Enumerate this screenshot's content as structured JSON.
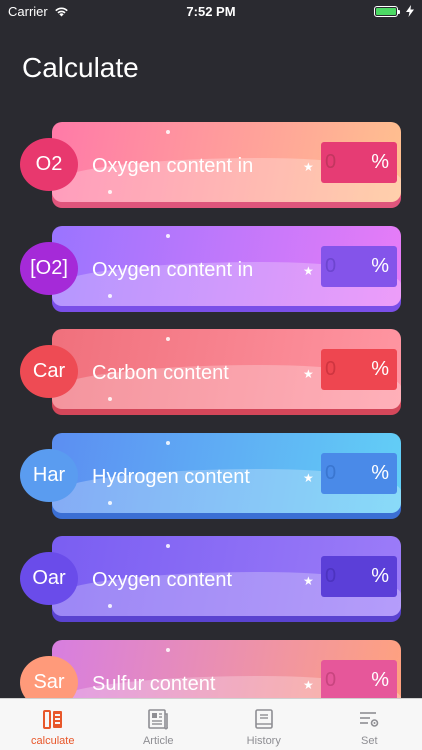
{
  "status_bar": {
    "carrier": "Carrier",
    "time": "7:52 PM"
  },
  "page_title": "Calculate",
  "cards": [
    {
      "badge": "O2",
      "label": "Oxygen content in",
      "value": "0",
      "unit": "%",
      "colors": {
        "from": "#ff7aa8",
        "to": "#ffc08f",
        "shadow": "#e0557c",
        "badge": "#e8386e",
        "input": "#e63c74",
        "placeholder": "#c2365f"
      }
    },
    {
      "badge": "[O2]",
      "label": "Oxygen content in",
      "value": "0",
      "unit": "%",
      "colors": {
        "from": "#9a74ff",
        "to": "#e77cf7",
        "shadow": "#7a4fe8",
        "badge": "#a52ad8",
        "input": "#8454ea",
        "placeholder": "#6d45cf"
      }
    },
    {
      "badge": "Car",
      "label": "Carbon content",
      "value": "0",
      "unit": "%",
      "colors": {
        "from": "#f0707c",
        "to": "#ff96a2",
        "shadow": "#d4475a",
        "badge": "#ee4b54",
        "input": "#ee4650",
        "placeholder": "#cf3540"
      }
    },
    {
      "badge": "Har",
      "label": "Hydrogen content",
      "value": "0",
      "unit": "%",
      "colors": {
        "from": "#5c8ef2",
        "to": "#62cff6",
        "shadow": "#3b6fd4",
        "badge": "#5a9cf0",
        "input": "#4a8ae8",
        "placeholder": "#3a76d0"
      }
    },
    {
      "badge": "Oar",
      "label": "Oxygen content",
      "value": "0",
      "unit": "%",
      "colors": {
        "from": "#7a5ef2",
        "to": "#9c7cf8",
        "shadow": "#5a43d0",
        "badge": "#6a4cea",
        "input": "#5b3fd8",
        "placeholder": "#4c33bf"
      }
    },
    {
      "badge": "Sar",
      "label": "Sulfur content",
      "value": "0",
      "unit": "%",
      "colors": {
        "from": "#d77ee0",
        "to": "#ffa27e",
        "shadow": "#c05fa0",
        "badge": "#ff9a7a",
        "input": "#e6579a",
        "placeholder": "#c8457f"
      }
    }
  ],
  "tabs": [
    {
      "label": "calculate",
      "icon": "calculator-icon",
      "active": true
    },
    {
      "label": "Article",
      "icon": "newspaper-icon",
      "active": false
    },
    {
      "label": "History",
      "icon": "book-icon",
      "active": false
    },
    {
      "label": "Set",
      "icon": "settings-list-icon",
      "active": false
    }
  ]
}
